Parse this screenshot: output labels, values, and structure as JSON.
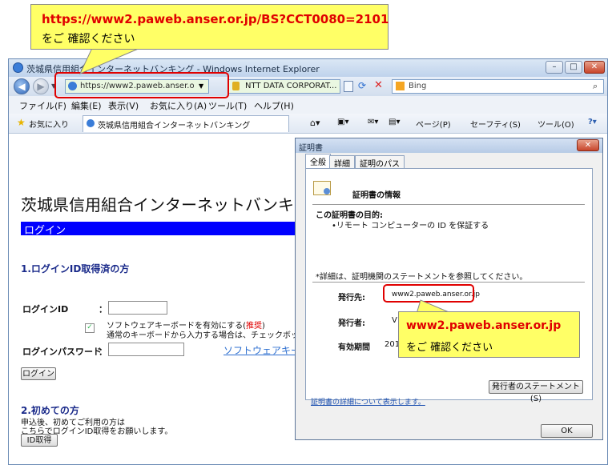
{
  "callout_top": {
    "url": "https://www2.paweb.anser.or.jp/BS?CCT0080=2101",
    "note": "をご 確認ください"
  },
  "callout_right": {
    "url": "www2.paweb.anser.or.jp",
    "note": "をご 確認ください"
  },
  "browser": {
    "title": "茨城県信用組合インターネットバンキング - Windows Internet Explorer",
    "address": "https://www2.paweb.anser.or.jp/BS",
    "site_identity": "NTT DATA CORPORAT...",
    "search_placeholder": "Bing",
    "menus": [
      "ファイル(F)",
      "編集(E)",
      "表示(V)",
      "お気に入り(A)",
      "ツール(T)",
      "ヘルプ(H)"
    ],
    "favorites_label": "お気に入り",
    "tab_title": "茨城県信用組合インターネットバンキング",
    "toolbar_page": "ページ(P)",
    "toolbar_safety": "セーフティ(S)",
    "toolbar_tools": "ツール(O)"
  },
  "page": {
    "heading": "茨城県信用組合インターネットバンキ",
    "login_bar": "ログイン",
    "section1": "1.ログインID取得済の方",
    "login_id_label": "ログインID",
    "colon": "：",
    "software_kb_line1": "ソフトウェアキーボードを有効にする(",
    "recommended": "推奨",
    "close_paren": ")",
    "software_kb_line2": "通常のキーボードから入力する場合は、チェックボック",
    "password_label": "ログインパスワード",
    "software_kb_link": "ソフトウェアキー",
    "login_button": "ログイン",
    "section2": "2.初めての方",
    "first_line1": "申込後、初めてご利用の方は",
    "first_line2": "こちらでログインID取得をお願いします。",
    "id_button": "ID取得"
  },
  "cert": {
    "title": "証明書",
    "tabs": [
      "全般",
      "詳細",
      "証明のパス"
    ],
    "info_heading": "証明書の情報",
    "purpose_heading": "この証明書の目的:",
    "purpose_item": "•リモート コンピューターの ID を保証する",
    "details_note": "*詳細は、証明機関のステートメントを参照してください。",
    "issued_to_label": "発行先:",
    "issued_to_value": "www2.paweb.anser.or.jp",
    "issued_by_label": "発行者:",
    "issued_by_value": "V",
    "valid_label": "有効期間",
    "valid_value": "201",
    "issuer_statement_button": "発行者のステートメント(S)",
    "details_link": "証明書の詳細について表示します。",
    "ok_button": "OK"
  }
}
